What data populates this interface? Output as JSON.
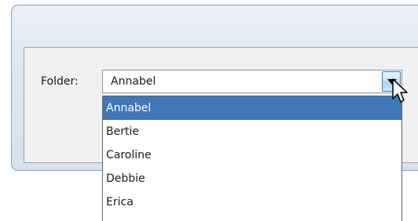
{
  "form": {
    "folder_label": "Folder:",
    "folder_value": "Annabel"
  },
  "dropdown": {
    "selected_index": 0,
    "options": [
      "Annabel",
      "Bertie",
      "Caroline",
      "Debbie",
      "Erica"
    ]
  },
  "colors": {
    "selection": "#3f77b8",
    "window_frame": "#8ea2b8",
    "panel_background": "#f0f0f0"
  },
  "icons": {
    "combo_arrow": "chevron-down-icon",
    "cursor": "mouse-pointer-icon"
  }
}
